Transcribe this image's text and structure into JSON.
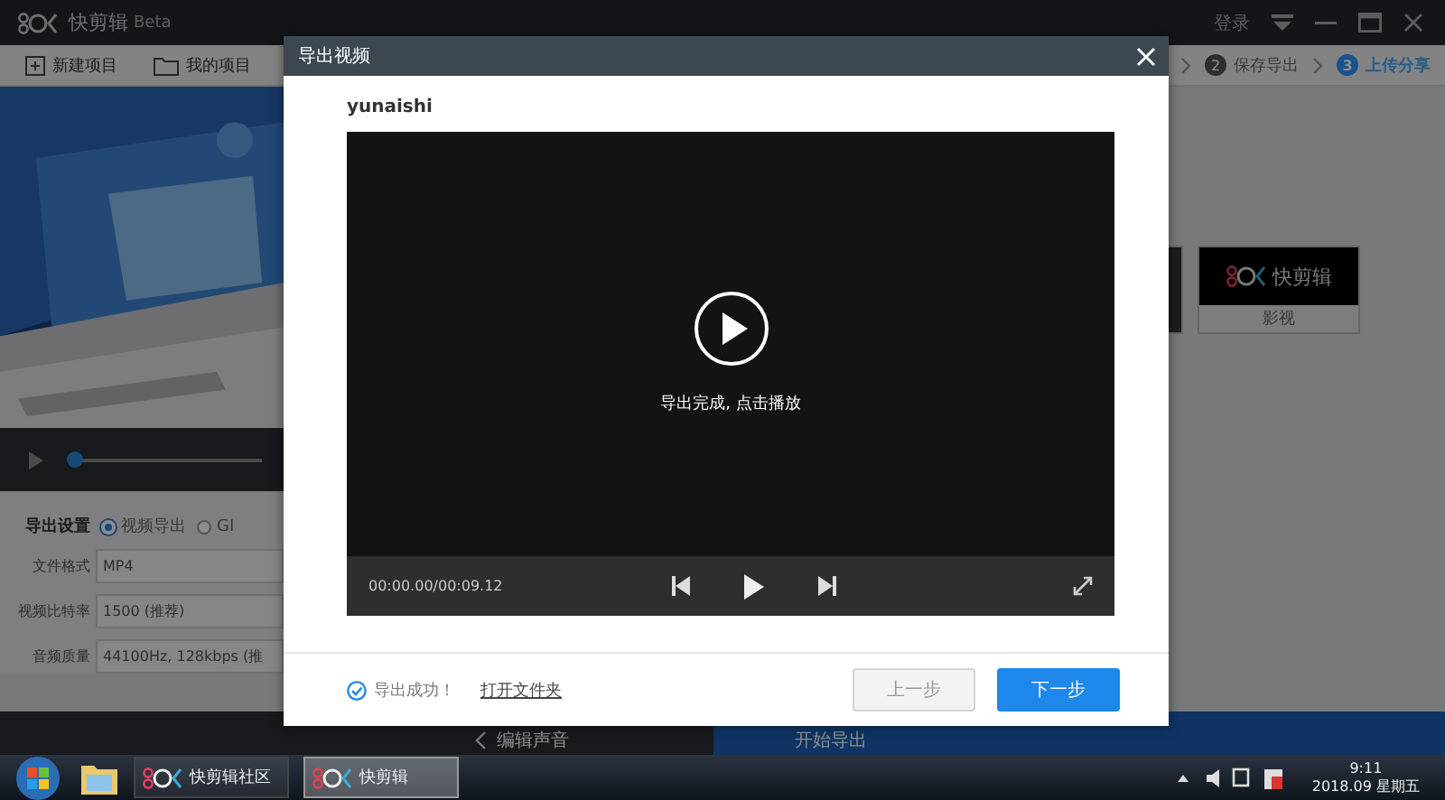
{
  "app": {
    "name": "快剪辑",
    "badge": "Beta",
    "login": "登录"
  },
  "toolbar": [
    "新建项目",
    "我的项目"
  ],
  "steps": [
    {
      "number": "2",
      "label": "保存导出",
      "selected": false
    },
    {
      "number": "3",
      "label": "上传分享",
      "selected": true
    }
  ],
  "preview": {
    "level": 0.03
  },
  "template_card": {
    "label": "影视",
    "logo_text": "快剪辑"
  },
  "export_settings": {
    "label": "导出设置",
    "options": [
      {
        "label": "视频导出",
        "selected": true
      },
      {
        "label": "GI",
        "selected": false
      }
    ],
    "fields": [
      {
        "label": "文件格式",
        "value": "MP4"
      },
      {
        "label": "视频比特率",
        "value": "1500 (推荐)"
      },
      {
        "label": "音频质量",
        "value": "44100Hz, 128kbps (推"
      }
    ]
  },
  "bottom_bar": {
    "back": "编辑声音",
    "start": "开始导出"
  },
  "dialog": {
    "title": "导出视频",
    "file_name": "yunaishi",
    "player": {
      "message": "导出完成, 点击播放",
      "time": "00:00.00/00:09.12"
    },
    "status": "导出成功！",
    "open_folder": "打开文件夹",
    "buttons": [
      {
        "label": "上一步",
        "kind": "secondary"
      },
      {
        "label": "下一步",
        "kind": "primary"
      }
    ]
  },
  "taskbar": {
    "tasks": [
      {
        "label": "快剪辑社区",
        "selected": false
      },
      {
        "label": "快剪辑",
        "selected": true
      }
    ],
    "time": "9:11",
    "date": "2018.09 星期五"
  }
}
